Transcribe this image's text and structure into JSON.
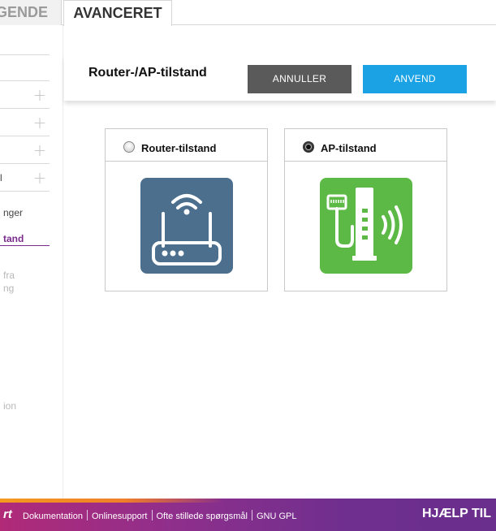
{
  "tabs": {
    "basic_fragment": "GENDE",
    "advanced": "AVANCERET"
  },
  "sidebar": {
    "fragment_1": "l",
    "item_indstillinger": "nger",
    "item_active": "tand",
    "item_opdatering_line1": "fra",
    "item_opdatering_line2": "ng",
    "item_administration": "ion"
  },
  "header": {
    "title": "Router-/AP-tilstand",
    "cancel_label": "ANNULLER",
    "apply_label": "ANVEND"
  },
  "modes": {
    "router": {
      "label": "Router-tilstand",
      "selected": false,
      "icon": "router-icon",
      "tile_color": "#4d6f8e"
    },
    "ap": {
      "label": "AP-tilstand",
      "selected": true,
      "icon": "access-point-icon",
      "tile_color": "#5cb946"
    }
  },
  "footer": {
    "brand_fragment": "rt",
    "links": [
      "Dokumentation",
      "Onlinesupport",
      "Ofte stillede spørgsmål",
      "GNU GPL"
    ],
    "help": "HJÆLP TIL"
  },
  "colors": {
    "accent_purple": "#7b2a8e",
    "apply_blue": "#1aa2e4",
    "cancel_grey": "#5a5a5a"
  }
}
